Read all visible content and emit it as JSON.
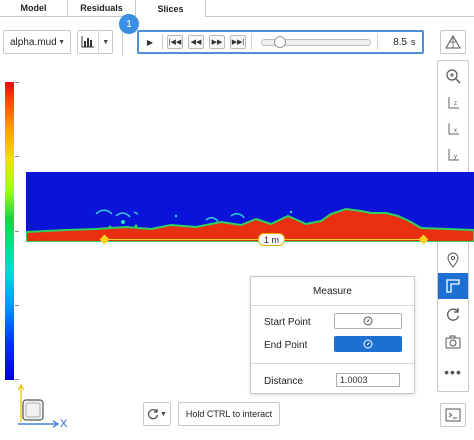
{
  "tabs": [
    "Model",
    "Residuals",
    "Slices"
  ],
  "active_tab": "Slices",
  "toolbar": {
    "field_select": "alpha.mud",
    "step_badge": "1"
  },
  "player": {
    "time_value": "8.5",
    "time_unit": "s",
    "slider_fraction": 0.17
  },
  "right_toolbar": {
    "view_labels": [
      "z",
      "x",
      "y",
      "123"
    ],
    "active_tool": "measure"
  },
  "viewport": {
    "ruler_label": "1 m",
    "axis_label_x": "X",
    "colors": {
      "background": "#0a14d8",
      "mud": "#e83010",
      "interface": "#30d060",
      "ruler": "#ffd020"
    }
  },
  "measure": {
    "title": "Measure",
    "start_label": "Start Point",
    "end_label": "End Point",
    "distance_label": "Distance",
    "distance_value": "1.0003"
  },
  "bottom": {
    "hold_label": "Hold CTRL to interact"
  }
}
